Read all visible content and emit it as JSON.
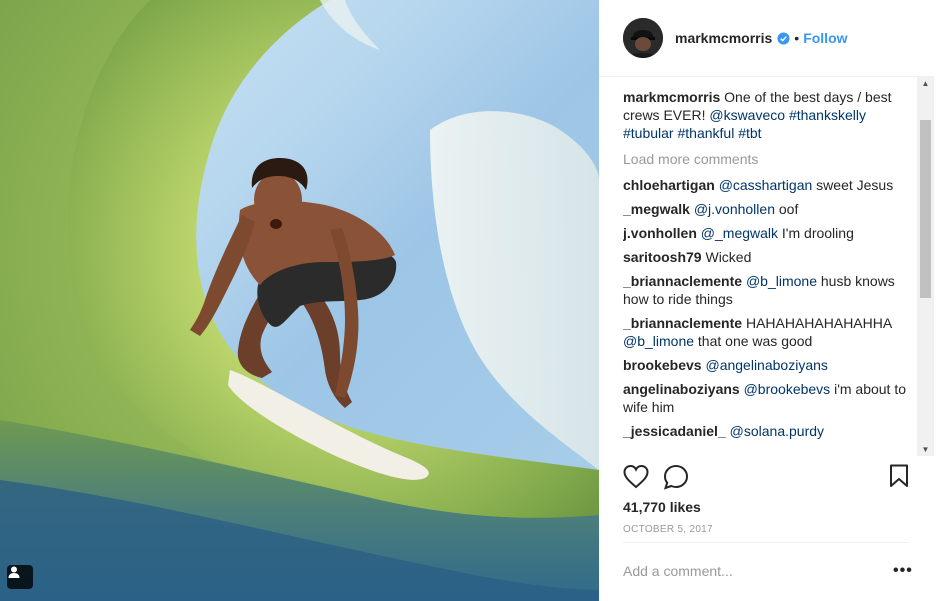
{
  "post": {
    "username": "markmcmorris",
    "verified": true,
    "separator": "•",
    "follow_label": "Follow",
    "caption": {
      "user": "markmcmorris",
      "text": " One of the best days / best crews EVER! ",
      "tags": [
        "@kswaveco",
        "#thankskelly",
        "#tubular",
        "#thankful",
        "#tbt"
      ]
    },
    "load_more_label": "Load more comments",
    "comments": [
      {
        "user": "chloehartigan",
        "mention": "@casshartigan",
        "text": " sweet Jesus"
      },
      {
        "user": "_megwalk",
        "mention": "@j.vonhollen",
        "text": " oof"
      },
      {
        "user": "j.vonhollen",
        "mention": "@_megwalk",
        "text": " I'm drooling"
      },
      {
        "user": "saritoosh79",
        "mention": "",
        "text": " Wicked"
      },
      {
        "user": "_briannaclemente",
        "mention": "@b_limone",
        "text": " husb knows how to ride things"
      },
      {
        "user": "_briannaclemente",
        "mention": "",
        "text": " HAHAHAHAHAHAHHA ",
        "mention2": "@b_limone",
        "text2": " that one was good"
      },
      {
        "user": "brookebevs",
        "mention": "@angelinaboziyans",
        "text": ""
      },
      {
        "user": "angelinaboziyans",
        "mention": "@brookebevs",
        "text": " i'm about to wife him"
      },
      {
        "user": "_jessicadaniel_",
        "mention": "@solana.purdy",
        "text": ""
      }
    ],
    "likes": "41,770 likes",
    "date": "OCTOBER 5, 2017",
    "add_comment_placeholder": "Add a comment...",
    "more_options": "•••"
  },
  "icons": {
    "like": "heart-icon",
    "comment": "comment-bubble-icon",
    "save": "bookmark-icon",
    "tag": "person-tag-icon",
    "verified": "verified-badge-icon"
  },
  "colors": {
    "link": "#003569",
    "follow": "#3897f0",
    "muted": "#999999",
    "text": "#262626"
  }
}
